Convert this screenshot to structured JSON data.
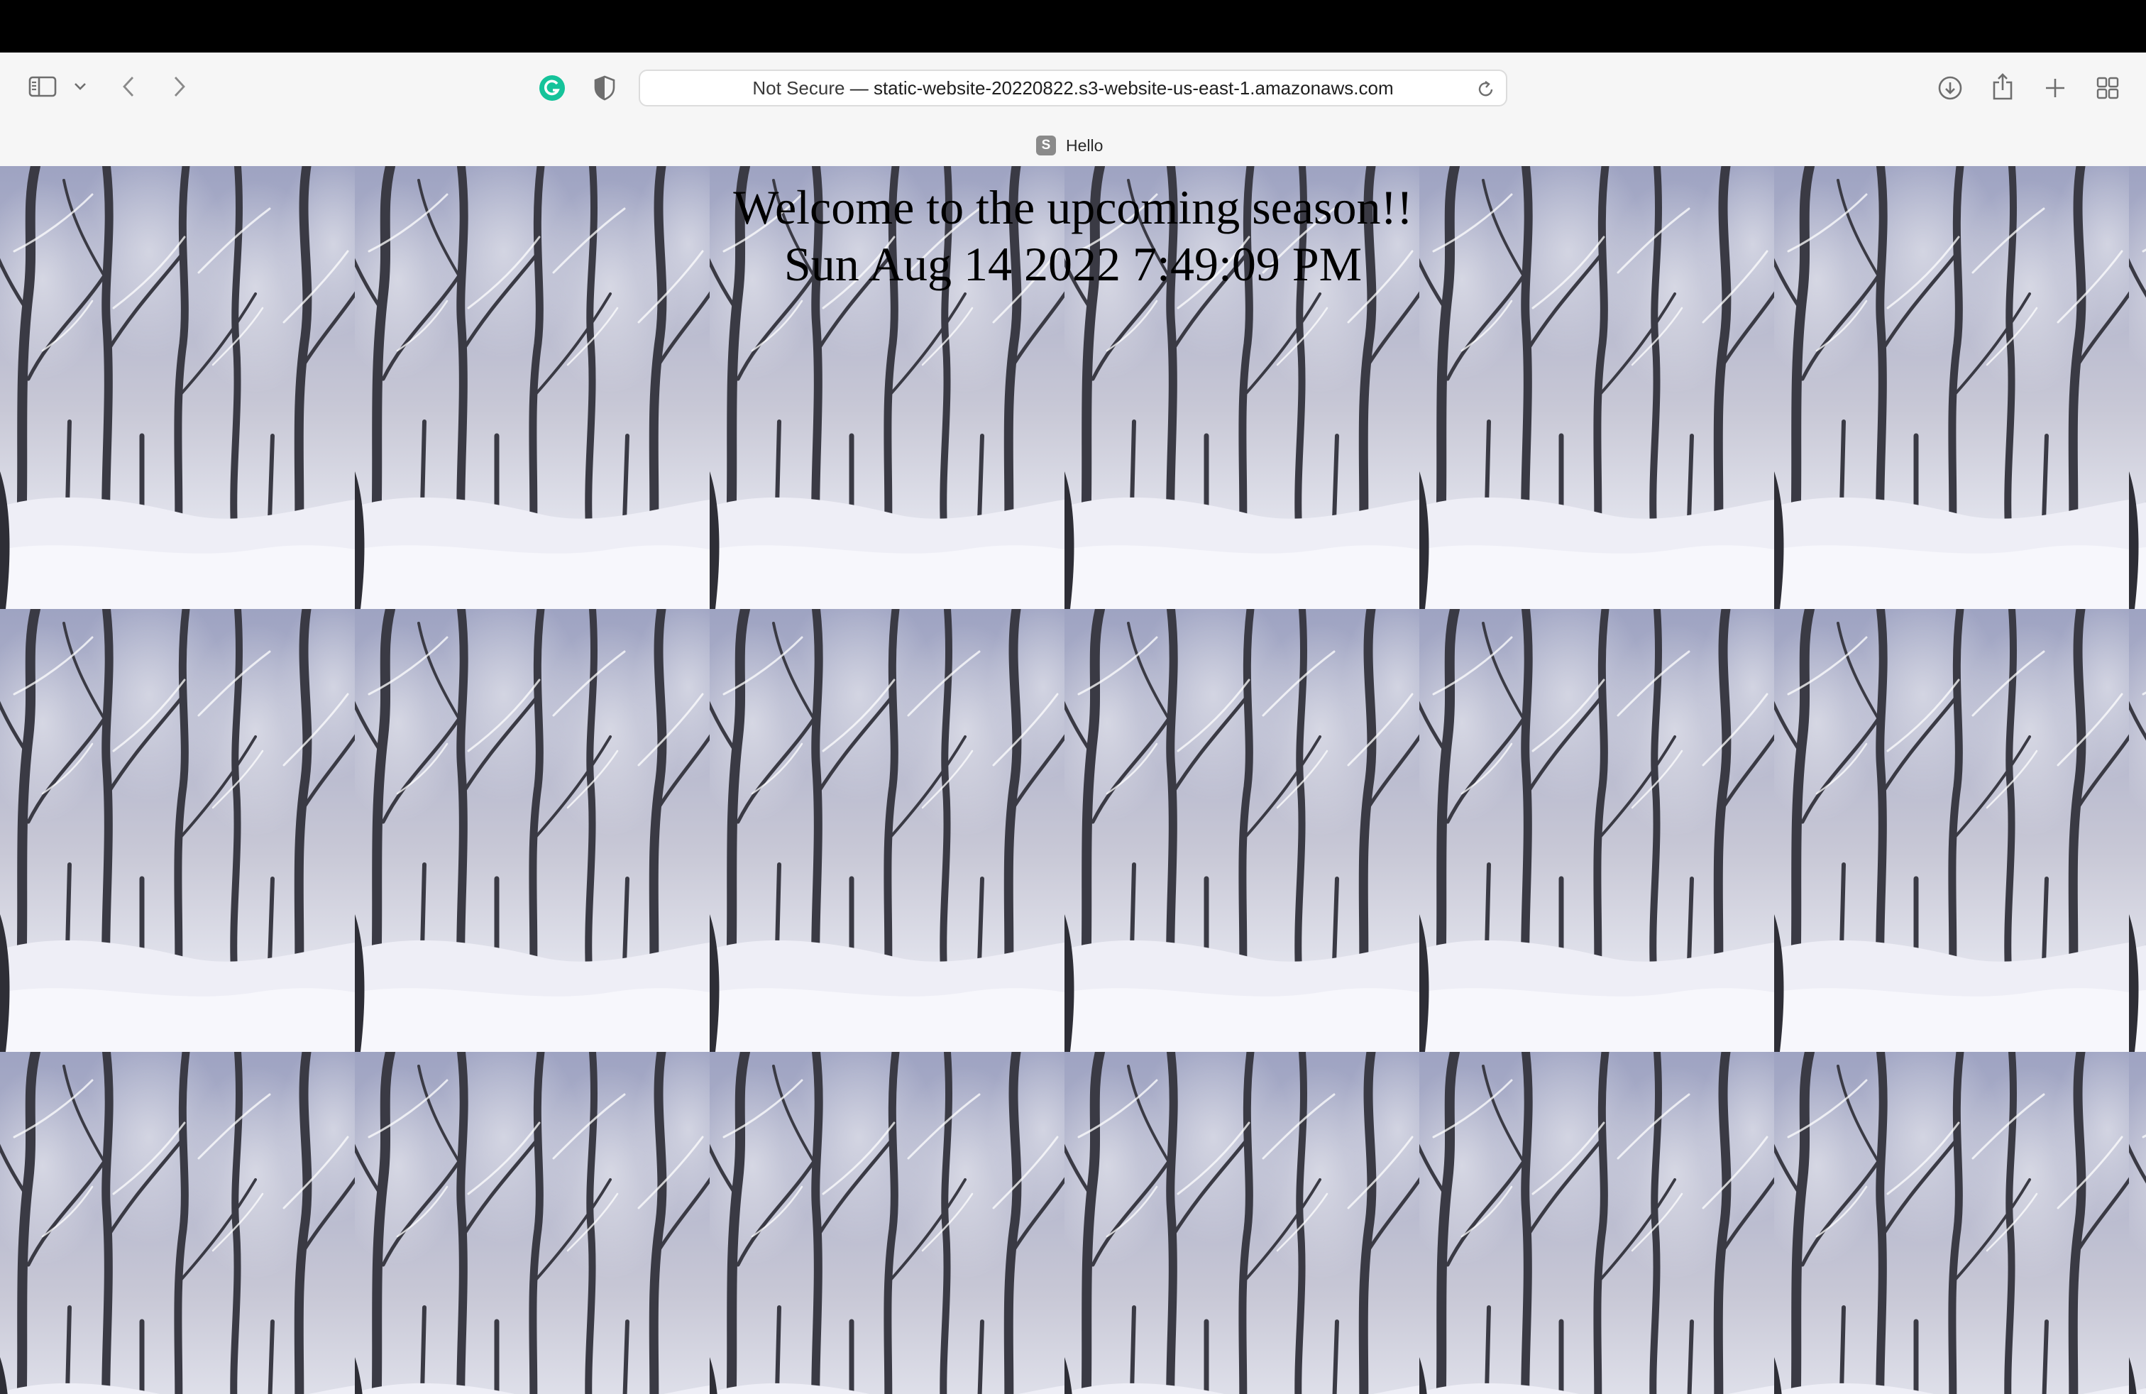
{
  "browser": {
    "address": {
      "security_label": "Not Secure",
      "separator": "—",
      "url": "static-website-20220822.s3-website-us-east-1.amazonaws.com"
    },
    "tab": {
      "favicon_letter": "S",
      "title": "Hello"
    },
    "icons": {
      "sidebar": "sidebar-icon",
      "sidebar_menu": "chevron-down-icon",
      "back": "chevron-left-icon",
      "forward": "chevron-right-icon",
      "grammarly": "grammarly-icon",
      "privacy": "shield-icon",
      "reload": "reload-icon",
      "downloads": "download-icon",
      "share": "share-icon",
      "new_tab": "plus-icon",
      "tab_overview": "grid-icon"
    }
  },
  "page": {
    "heading": "Welcome to the upcoming season!!",
    "datetime": "Sun Aug 14 2022 7:49:09 PM",
    "background": "snowy-forest-image"
  },
  "colors": {
    "grammarly_green": "#15c39a",
    "toolbar_bg": "#f6f6f6"
  }
}
